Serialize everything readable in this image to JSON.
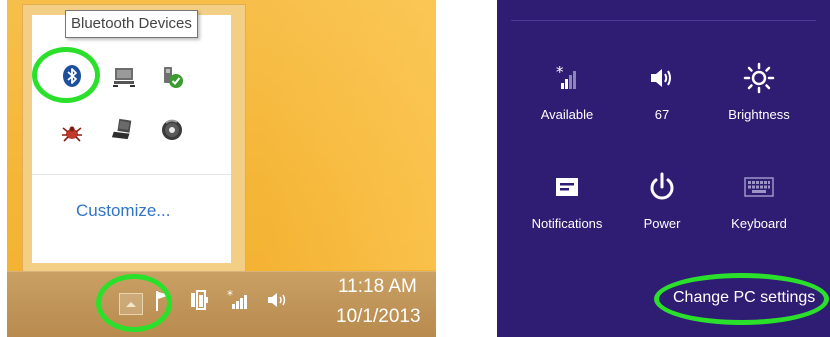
{
  "colors": {
    "highlight": "#2be02b",
    "charms_bg": "#2f1d74",
    "desktop_bg": "#f6b73c",
    "link": "#2f74c5"
  },
  "tray_popup": {
    "tooltip": "Bluetooth Devices",
    "customize_label": "Customize...",
    "icons": [
      "bluetooth-icon",
      "network-drive-icon",
      "safely-remove-hardware-icon",
      "antivirus-icon",
      "touchpad-icon",
      "media-player-icon"
    ]
  },
  "taskbar": {
    "time": "11:18 AM",
    "date": "10/1/2013",
    "icons": [
      "show-hidden-icons-arrow-icon",
      "action-center-flag-icon",
      "power-plug-icon",
      "wireless-signal-icon",
      "speaker-icon"
    ]
  },
  "settings_charm": {
    "tiles": [
      {
        "label": "Available",
        "icon": "wireless-network-icon"
      },
      {
        "label": "67",
        "icon": "volume-icon"
      },
      {
        "label": "Brightness",
        "icon": "brightness-icon"
      },
      {
        "label": "Notifications",
        "icon": "notifications-icon"
      },
      {
        "label": "Power",
        "icon": "power-icon"
      },
      {
        "label": "Keyboard",
        "icon": "keyboard-icon"
      }
    ],
    "change_pc_settings": "Change PC settings"
  }
}
